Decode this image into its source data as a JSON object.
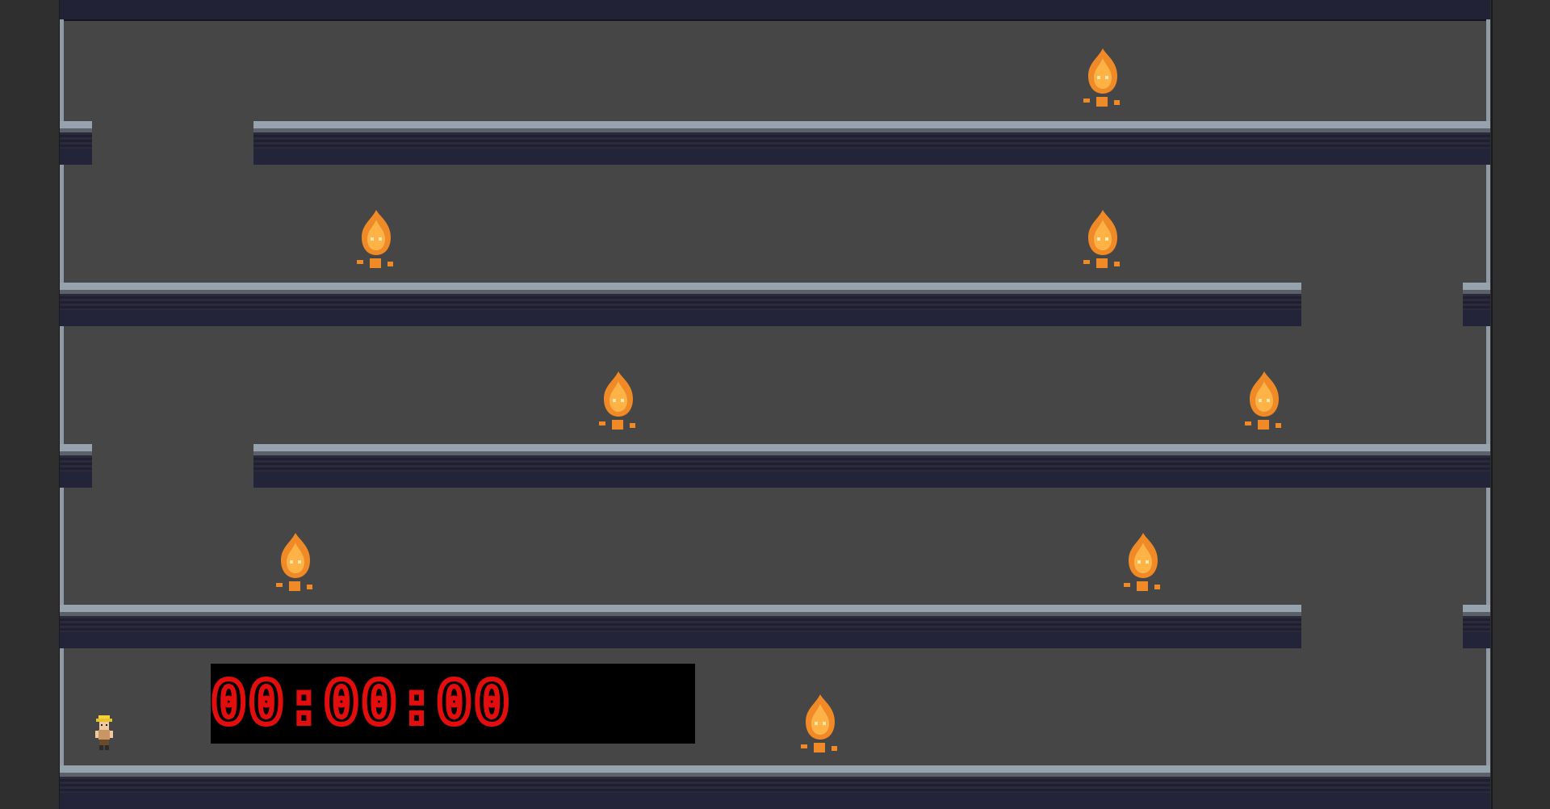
{
  "timer": {
    "display": "00:00:00",
    "digit_color": "#e40d0d"
  },
  "colors": {
    "floor_background": "#464646",
    "ledge_cap": "#94a3ad",
    "ledge_body": "#23233a",
    "flame_outer": "#f08a26",
    "flame_inner": "#ffb347"
  },
  "entities": {
    "flame_enemies": [
      {
        "name": "flame-enemy-1"
      },
      {
        "name": "flame-enemy-2"
      },
      {
        "name": "flame-enemy-3"
      },
      {
        "name": "flame-enemy-4"
      },
      {
        "name": "flame-enemy-5"
      },
      {
        "name": "flame-enemy-6"
      },
      {
        "name": "flame-enemy-7"
      },
      {
        "name": "flame-enemy-8"
      },
      {
        "name": "flame-enemy-9"
      }
    ],
    "player": {
      "icon": "miner-character-icon"
    }
  }
}
